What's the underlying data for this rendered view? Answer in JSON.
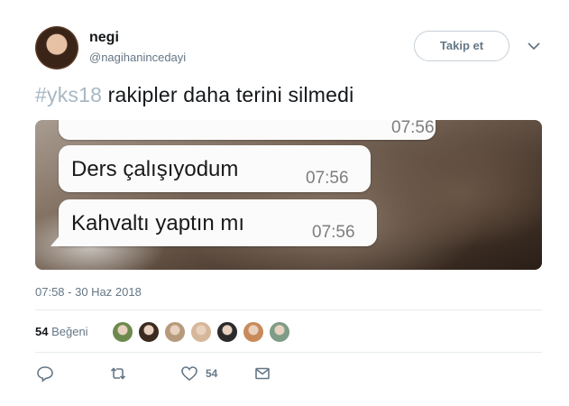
{
  "user": {
    "display_name": "negi",
    "username": "@nagihanincedayi",
    "avatar_icon": "user-avatar"
  },
  "follow_button_label": "Takip et",
  "more_menu_icon": "chevron-down-icon",
  "tweet": {
    "hashtag": "#yks18",
    "text": " rakipler daha terini silmedi"
  },
  "media": {
    "messages": [
      {
        "text": "",
        "time": "07:56"
      },
      {
        "text": "Ders çalışıyodum",
        "time": "07:56"
      },
      {
        "text": "Kahvaltı yaptın mı",
        "time": "07:56"
      }
    ]
  },
  "timestamp": "07:58 - 30 Haz 2018",
  "likes": {
    "count": "54",
    "label": "Beğeni",
    "avatar_colors": [
      "#6d8a4e",
      "#3b2a1f",
      "#b79a7c",
      "#d6b79a",
      "#2b2b2b",
      "#c98a5a",
      "#7f9c86"
    ]
  },
  "actions": {
    "reply_icon": "reply-icon",
    "retweet_icon": "retweet-icon",
    "like_icon": "heart-icon",
    "like_count": "54",
    "dm_icon": "envelope-icon"
  }
}
